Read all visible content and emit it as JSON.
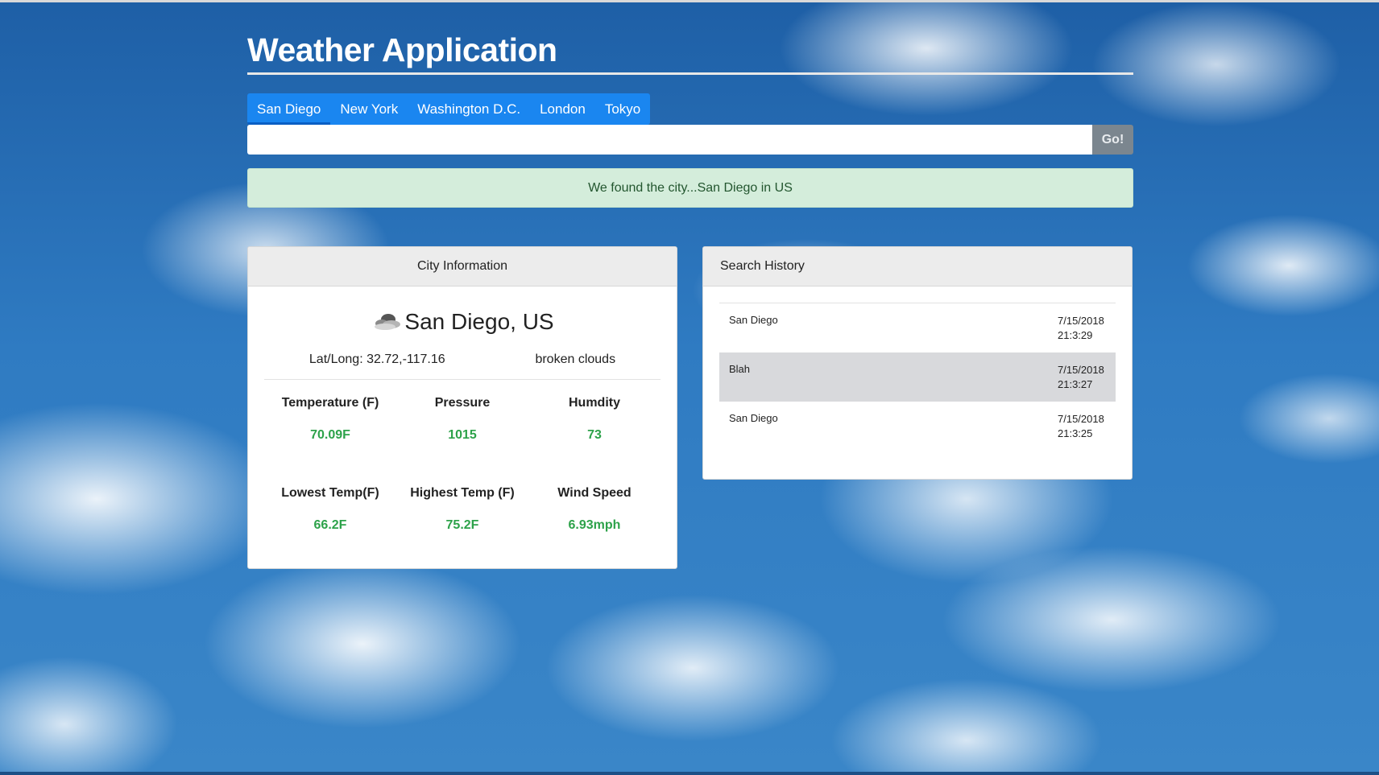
{
  "app": {
    "title": "Weather Application"
  },
  "tabs": [
    {
      "label": "San Diego",
      "active": true
    },
    {
      "label": "New York",
      "active": false
    },
    {
      "label": "Washington D.C.",
      "active": false
    },
    {
      "label": "London",
      "active": false
    },
    {
      "label": "Tokyo",
      "active": false
    }
  ],
  "search": {
    "value": "",
    "placeholder": "",
    "button_label": "Go!"
  },
  "alert": {
    "message": "We found the city...San Diego in US",
    "status": "success"
  },
  "city_info": {
    "header": "City Information",
    "icon": "cloud-icon",
    "city": "San Diego, US",
    "latlong": "Lat/Long: 32.72,-117.16",
    "description": "broken clouds",
    "stats": [
      {
        "label": "Temperature (F)",
        "value": "70.09F"
      },
      {
        "label": "Pressure",
        "value": "1015"
      },
      {
        "label": "Humdity",
        "value": "73"
      },
      {
        "label": "Lowest Temp(F)",
        "value": "66.2F"
      },
      {
        "label": "Highest Temp (F)",
        "value": "75.2F"
      },
      {
        "label": "Wind Speed",
        "value": "6.93mph"
      }
    ]
  },
  "history": {
    "header": "Search History",
    "items": [
      {
        "city": "San Diego",
        "date": "7/15/2018",
        "time": "21:3:29",
        "highlighted": false
      },
      {
        "city": "Blah",
        "date": "7/15/2018",
        "time": "21:3:27",
        "highlighted": true
      },
      {
        "city": "San Diego",
        "date": "7/15/2018",
        "time": "21:3:25",
        "highlighted": false
      }
    ]
  },
  "colors": {
    "tab_bar": "#1a86f0",
    "go_button": "#7b868f",
    "alert_bg": "#d4eddb",
    "stat_value": "#2da24a",
    "highlight_row": "#d8d9dc"
  }
}
